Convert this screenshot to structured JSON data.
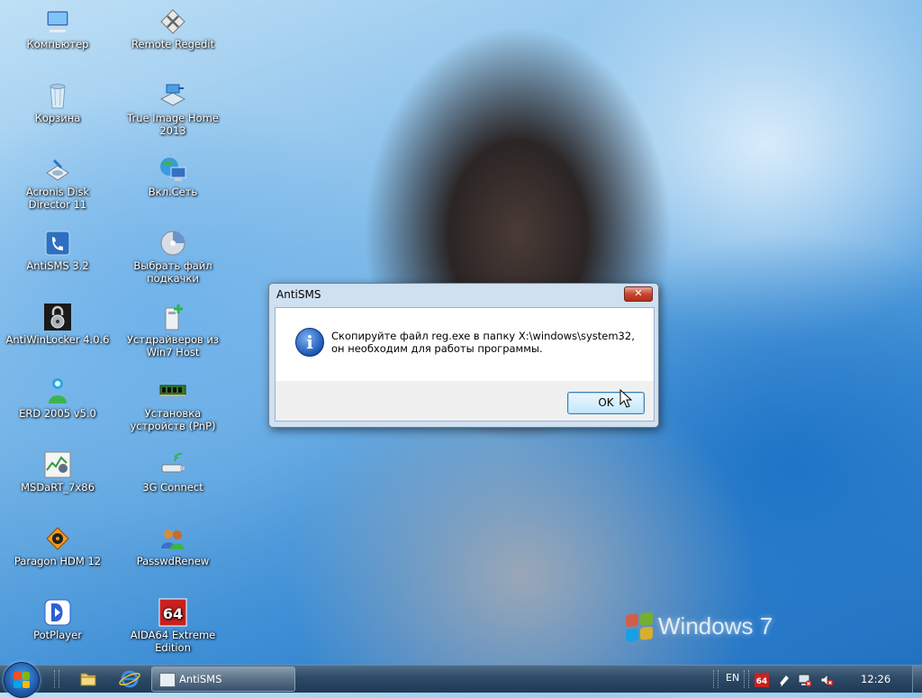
{
  "desktop": {
    "icons": [
      {
        "label": "Компьютер",
        "icon": "computer-icon"
      },
      {
        "label": "Корзина",
        "icon": "recycle-bin-icon"
      },
      {
        "label": "Acronis Disk Director 11",
        "icon": "acronis-disk-icon"
      },
      {
        "label": "AntiSMS 3.2",
        "icon": "antisms-icon"
      },
      {
        "label": "AntiWinLocker 4.0.6",
        "icon": "lock-icon"
      },
      {
        "label": "ERD 2005 v5.0",
        "icon": "erd-icon"
      },
      {
        "label": "MSDaRT_7x86",
        "icon": "msdart-icon"
      },
      {
        "label": "Paragon HDM 12",
        "icon": "paragon-icon"
      },
      {
        "label": "PotPlayer",
        "icon": "potplayer-icon"
      },
      {
        "label": "Remote Regedit",
        "icon": "regedit-icon"
      },
      {
        "label": "True Image Home 2013",
        "icon": "true-image-icon"
      },
      {
        "label": "Вкл.Сеть",
        "icon": "network-icon"
      },
      {
        "label": "Выбрать файл подкачки",
        "icon": "pagefile-icon"
      },
      {
        "label": "Устдрайверов из Win7 Host",
        "icon": "driver-install-icon"
      },
      {
        "label": "Установка устройств (PnP)",
        "icon": "pnp-device-icon"
      },
      {
        "label": "3G Connect",
        "icon": "modem-icon"
      },
      {
        "label": "PasswdRenew",
        "icon": "users-icon"
      },
      {
        "label": "AIDA64 Extreme Edition",
        "icon": "aida64-icon"
      }
    ],
    "watermark": "Windows 7",
    "watermark_main": "Windows",
    "watermark_num": "7"
  },
  "dialog": {
    "title": "AntiSMS",
    "close_label": "✕",
    "message": "Скопируйте файл reg.exe в папку X:\\windows\\system32, он необходим для работы программы.",
    "ok_label": "OK",
    "icon": "info-icon"
  },
  "taskbar": {
    "start_icon": "windows-start-icon",
    "pinned": [
      "explorer-icon",
      "internet-explorer-icon"
    ],
    "task_label": "AntiSMS",
    "language": "EN",
    "tray_icons": [
      "aida64-tray-icon",
      "pen-tray-icon",
      "network-tray-icon",
      "volume-muted-icon"
    ],
    "clock": "12:26"
  },
  "colors": {
    "taskbar": "#2d4a66",
    "dialog_frame": "#cfe0f1",
    "close_red": "#c7462f",
    "info_blue": "#1d55b5"
  }
}
